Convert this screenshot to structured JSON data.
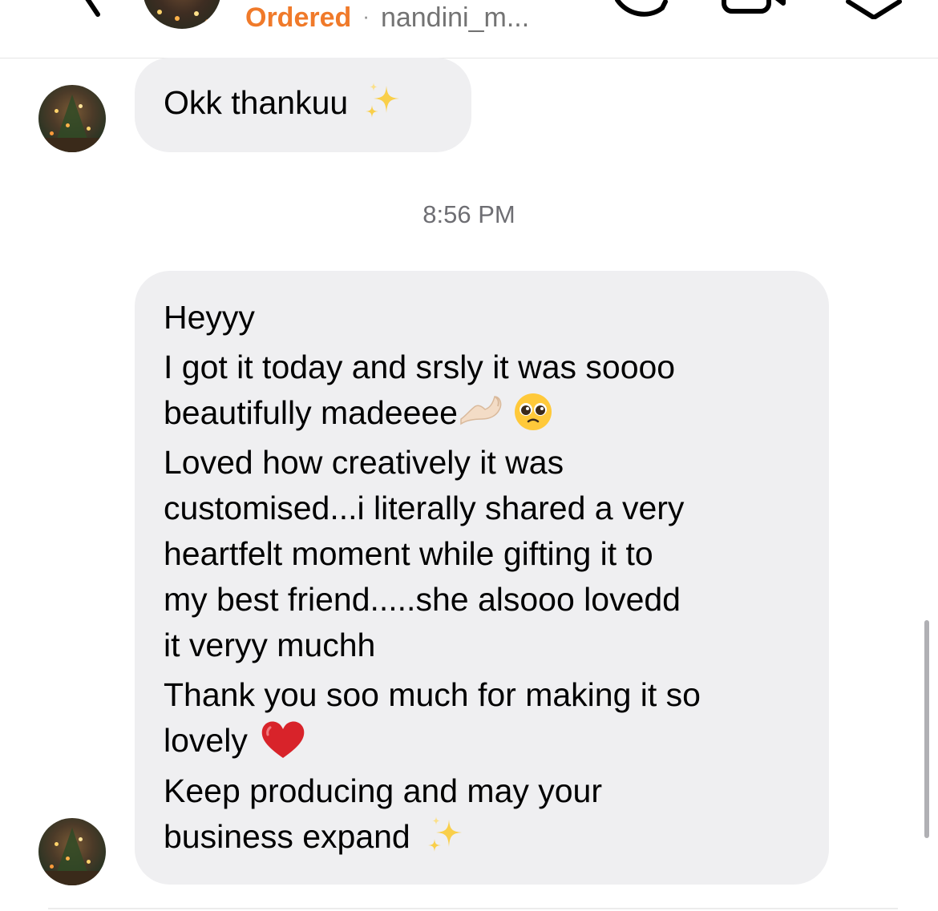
{
  "header": {
    "status_label": "Ordered",
    "separator": "·",
    "username": "nandini_m..."
  },
  "messages": [
    {
      "lines": [
        "Okk thankuu"
      ],
      "emoji": "sparkles"
    }
  ],
  "timestamp": "8:56 PM",
  "message_2": {
    "line_1": "Heyyy",
    "line_2": "I got it today and srsly it was soooo",
    "line_3": "beautifully madeeee",
    "line_4": "Loved how creatively it was",
    "line_5": "customised...i literally shared a very",
    "line_6": "heartfelt moment while gifting it to",
    "line_7": "my best friend.....she alsooo lovedd",
    "line_8": "it veryy muchh",
    "line_9": "Thank you soo much for making it so",
    "line_10": "lovely",
    "line_11": "Keep producing and may your",
    "line_12": "business expand"
  },
  "colors": {
    "status_orange": "#f07a2a",
    "bubble_gray": "#efeff1",
    "heart_red": "#d8232a"
  },
  "icons": [
    "back-arrow-icon",
    "phone-call-icon",
    "video-call-icon",
    "info-icon",
    "sparkles-icon",
    "pinching-hand-icon",
    "pleading-face-icon",
    "red-heart-icon"
  ]
}
